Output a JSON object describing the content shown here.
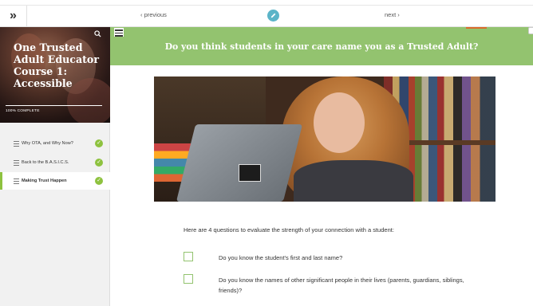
{
  "nav": {
    "toggle_glyph": "»",
    "previous_label": "‹ previous",
    "next_label": "next ›"
  },
  "course": {
    "title": "One Trusted Adult Educator Course 1: Accessible",
    "progress_text": "100% COMPLETE",
    "progress_percent": 100
  },
  "lessons": [
    {
      "label": "Why OTA, and Why Now?",
      "complete": true,
      "active": false
    },
    {
      "label": "Back to the B.A.S.I.C.S.",
      "complete": true,
      "active": false
    },
    {
      "label": "Making Trust Happen",
      "complete": true,
      "active": true
    }
  ],
  "main": {
    "heading": "Do you think students in your care name you as a Trusted Adult?",
    "intro": "Here are 4 questions to evaluate the strength of your connection with a student:",
    "questions": [
      {
        "text": "Do you know the student's first and last name?",
        "checked": false
      },
      {
        "text": "Do you know the names of other significant people in their lives (parents, guardians, siblings, friends)?",
        "checked": false
      }
    ]
  },
  "colors": {
    "accent_green": "#93c36f",
    "check_green": "#8ec23f",
    "edit_blue": "#5bb4c8"
  },
  "icons": {
    "toggle": "double-chevron-right-icon",
    "search": "search-icon",
    "edit": "pencil-icon",
    "menu": "hamburger-icon",
    "lesson": "lines-icon",
    "check": "check-circle-icon"
  }
}
